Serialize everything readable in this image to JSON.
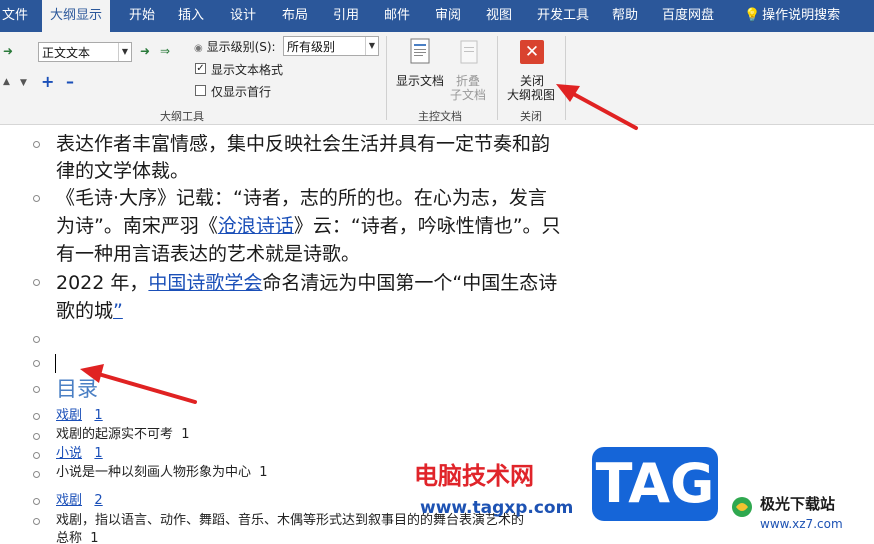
{
  "tabs": [
    {
      "label": "文件",
      "active": false
    },
    {
      "label": "大纲显示",
      "active": true
    },
    {
      "label": "开始",
      "active": false
    },
    {
      "label": "插入",
      "active": false
    },
    {
      "label": "设计",
      "active": false
    },
    {
      "label": "布局",
      "active": false
    },
    {
      "label": "引用",
      "active": false
    },
    {
      "label": "邮件",
      "active": false
    },
    {
      "label": "审阅",
      "active": false
    },
    {
      "label": "视图",
      "active": false
    },
    {
      "label": "开发工具",
      "active": false
    },
    {
      "label": "帮助",
      "active": false
    },
    {
      "label": "百度网盘",
      "active": false
    }
  ],
  "tell_me": {
    "label": "操作说明搜索"
  },
  "outline_tools": {
    "level_select": "正文文本",
    "show_level_label": "显示级别(S):",
    "show_level_value": "所有级别",
    "show_format_label": "显示文本格式",
    "show_format_checked": true,
    "first_line_label": "仅显示首行",
    "first_line_checked": false,
    "group_label": "大纲工具"
  },
  "master_doc": {
    "show_doc": "显示文档",
    "collapse_l1": "折叠",
    "collapse_l2": "子文档",
    "group_label": "主控文档"
  },
  "close": {
    "label_l1": "关闭",
    "label_l2": "大纲视图",
    "group_label": "关闭"
  },
  "doc": {
    "p1_l1": "表达作者丰富情感，集中反映社会生活并具有一定节奏和韵",
    "p1_l2": "律的文学体裁。",
    "p2_l1": "《毛诗·大序》记载：“诗者，志的所的也。在心为志，发言",
    "p2_l2a": "为诗”。南宋严羽《",
    "p2_l2link": "沧浪诗话",
    "p2_l2b": "》云：“诗者，吟咏性情也”。只",
    "p2_l3": "有一种用言语表达的艺术就是诗歌。",
    "p3_l1a": "2022 年，",
    "p3_l1link": "中国诗歌学会",
    "p3_l1b": "命名清远为中国第一个“中国生态诗",
    "p3_l2": "歌的城",
    "p3_l2end": "”",
    "toc_heading": "目录",
    "toc": [
      {
        "text": "戏剧",
        "page": "1",
        "underline": true
      },
      {
        "text": "戏剧的起源实不可考",
        "page": "1",
        "underline": false
      },
      {
        "text": "小说",
        "page": "1",
        "underline": true
      },
      {
        "text": "小说是一种以刻画人物形象为中心",
        "page": "1",
        "underline": false
      },
      {
        "text": "戏剧",
        "page": "2",
        "underline": true
      },
      {
        "text": "戏剧，指以语言、动作、舞蹈、音乐、木偶等形式达到叙事目的的舞台表演艺术的",
        "page": "",
        "underline": false
      },
      {
        "text": "总称",
        "page": "1",
        "underline": false
      }
    ]
  },
  "watermark": {
    "site_cn": "电脑技术网",
    "site_url": "www.tagxp.com",
    "tag": "TAG",
    "brand": "极光下载站",
    "brand_url": "www.xz7.com"
  },
  "colors": {
    "ribbon_blue": "#2b579a",
    "close_red": "#d9432f",
    "annotation_arrow": "#e02222"
  }
}
